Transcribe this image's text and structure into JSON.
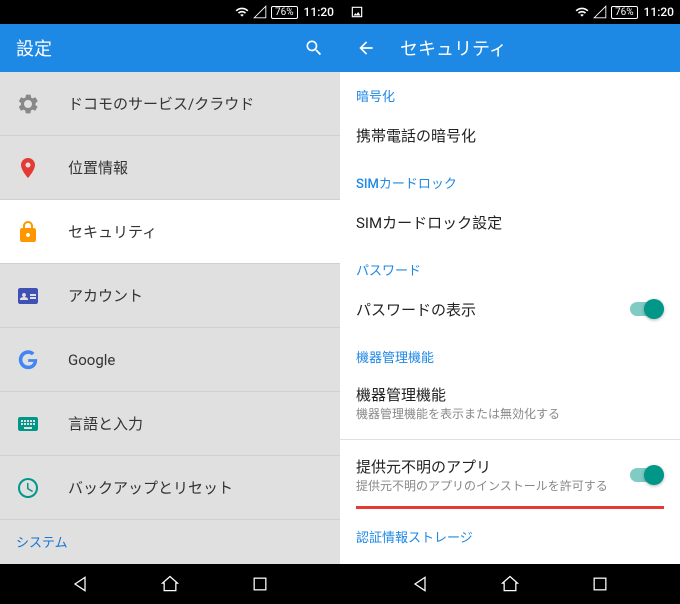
{
  "status": {
    "battery": "76%",
    "time": "11:20"
  },
  "left": {
    "app_title": "設定",
    "items": [
      {
        "label": "ドコモのサービス/クラウド"
      },
      {
        "label": "位置情報"
      },
      {
        "label": "セキュリティ"
      },
      {
        "label": "アカウント"
      },
      {
        "label": "Google"
      },
      {
        "label": "言語と入力"
      },
      {
        "label": "バックアップとリセット"
      }
    ],
    "category": "システム"
  },
  "right": {
    "app_title": "セキュリティ",
    "sections": {
      "encryption_header": "暗号化",
      "encryption_item": "携帯電話の暗号化",
      "sim_header": "SIMカードロック",
      "sim_item": "SIMカードロック設定",
      "password_header": "パスワード",
      "password_item": "パスワードの表示",
      "admin_header": "機器管理機能",
      "admin_item": "機器管理機能",
      "admin_desc": "機器管理機能を表示または無効化する",
      "unknown_item": "提供元不明のアプリ",
      "unknown_desc": "提供元不明のアプリのインストールを許可する",
      "cred_header": "認証情報ストレージ"
    }
  }
}
